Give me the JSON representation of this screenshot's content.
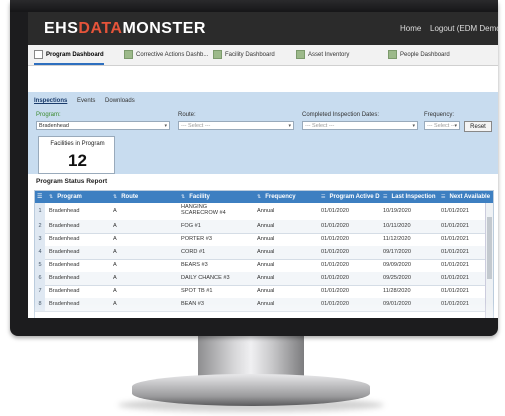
{
  "app": {
    "logo_part1": "EHS",
    "logo_part2": "DATA",
    "logo_part3": "MONSTER",
    "nav_home": "Home",
    "nav_logout": "Logout (EDM Demo"
  },
  "tabs": [
    {
      "label": "Program Dashboard"
    },
    {
      "label": "Corrective Actions Dashb..."
    },
    {
      "label": "Facility Dashboard"
    },
    {
      "label": "Asset Inventory"
    },
    {
      "label": "People Dashboard"
    }
  ],
  "subtabs": [
    "Inspections",
    "Events",
    "Downloads"
  ],
  "filters": {
    "program_label": "Program:",
    "program_value": "Bradenhead",
    "route_label": "Route:",
    "route_value": "--- Select ---",
    "dates_label": "Completed Inspection Dates:",
    "dates_value": "--- Select ---",
    "frequency_label": "Frequency:",
    "frequency_value": "--- Select ---",
    "reset_label": "Reset"
  },
  "kpi": {
    "label": "Facilities in Program",
    "value": "12"
  },
  "report": {
    "title": "Program Status Report",
    "columns": [
      "Program",
      "Route",
      "Facility",
      "Frequency",
      "Program Active D",
      "Last Inspection",
      "Next Available"
    ],
    "rows": [
      {
        "num": "1",
        "program": "Bradenhead",
        "route": "A",
        "facility": "HANGING SCARECROW #4",
        "frequency": "Annual",
        "active": "01/01/2020",
        "last": "10/19/2020",
        "next": "01/01/2021"
      },
      {
        "num": "2",
        "program": "Bradenhead",
        "route": "A",
        "facility": "FOG #1",
        "frequency": "Annual",
        "active": "01/01/2020",
        "last": "10/11/2020",
        "next": "01/01/2021"
      },
      {
        "num": "3",
        "program": "Bradenhead",
        "route": "A",
        "facility": "PORTER #3",
        "frequency": "Annual",
        "active": "01/01/2020",
        "last": "11/12/2020",
        "next": "01/01/2021"
      },
      {
        "num": "4",
        "program": "Bradenhead",
        "route": "A",
        "facility": "CORD #1",
        "frequency": "Annual",
        "active": "01/01/2020",
        "last": "09/17/2020",
        "next": "01/01/2021"
      },
      {
        "num": "5",
        "program": "Bradenhead",
        "route": "A",
        "facility": "BEARS #3",
        "frequency": "Annual",
        "active": "01/01/2020",
        "last": "09/09/2020",
        "next": "01/01/2021"
      },
      {
        "num": "6",
        "program": "Bradenhead",
        "route": "A",
        "facility": "DAILY CHANCE #3",
        "frequency": "Annual",
        "active": "01/01/2020",
        "last": "09/25/2020",
        "next": "01/01/2021"
      },
      {
        "num": "7",
        "program": "Bradenhead",
        "route": "A",
        "facility": "SPOT TB #1",
        "frequency": "Annual",
        "active": "01/01/2020",
        "last": "11/28/2020",
        "next": "01/01/2021"
      },
      {
        "num": "8",
        "program": "Bradenhead",
        "route": "A",
        "facility": "BEAN #3",
        "frequency": "Annual",
        "active": "01/01/2020",
        "last": "09/01/2020",
        "next": "01/01/2021"
      }
    ]
  },
  "colors": {
    "brand_accent": "#e5543a",
    "header_blue": "#3d7fc1",
    "panel_blue": "#c8dcef",
    "topbar": "#2b2b2b"
  }
}
